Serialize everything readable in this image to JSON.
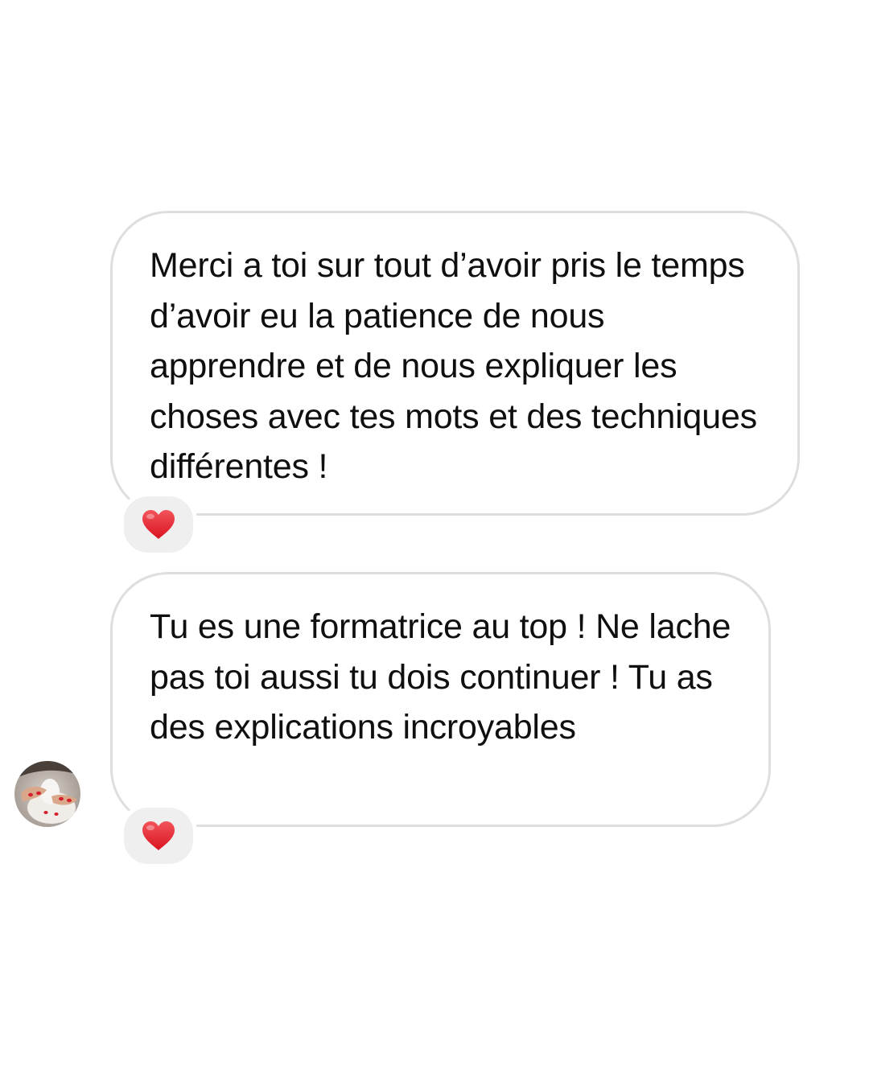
{
  "messages": [
    {
      "text": "Merci a toi sur tout d’avoir pris le temps d’avoir eu la patience de nous apprendre et de nous expliquer les choses avec tes mots et des techniques différentes !",
      "reaction": "heart-icon"
    },
    {
      "text": "Tu es une formatrice au top ! Ne lache pas toi aussi tu dois continuer ! Tu as des explications incroyables",
      "reaction": "heart-icon"
    }
  ],
  "colors": {
    "background": "#ffffff",
    "bubble_border": "#dedede",
    "reaction_background": "#efefef",
    "heart": "#e5212e",
    "text": "#0f0f0f"
  }
}
